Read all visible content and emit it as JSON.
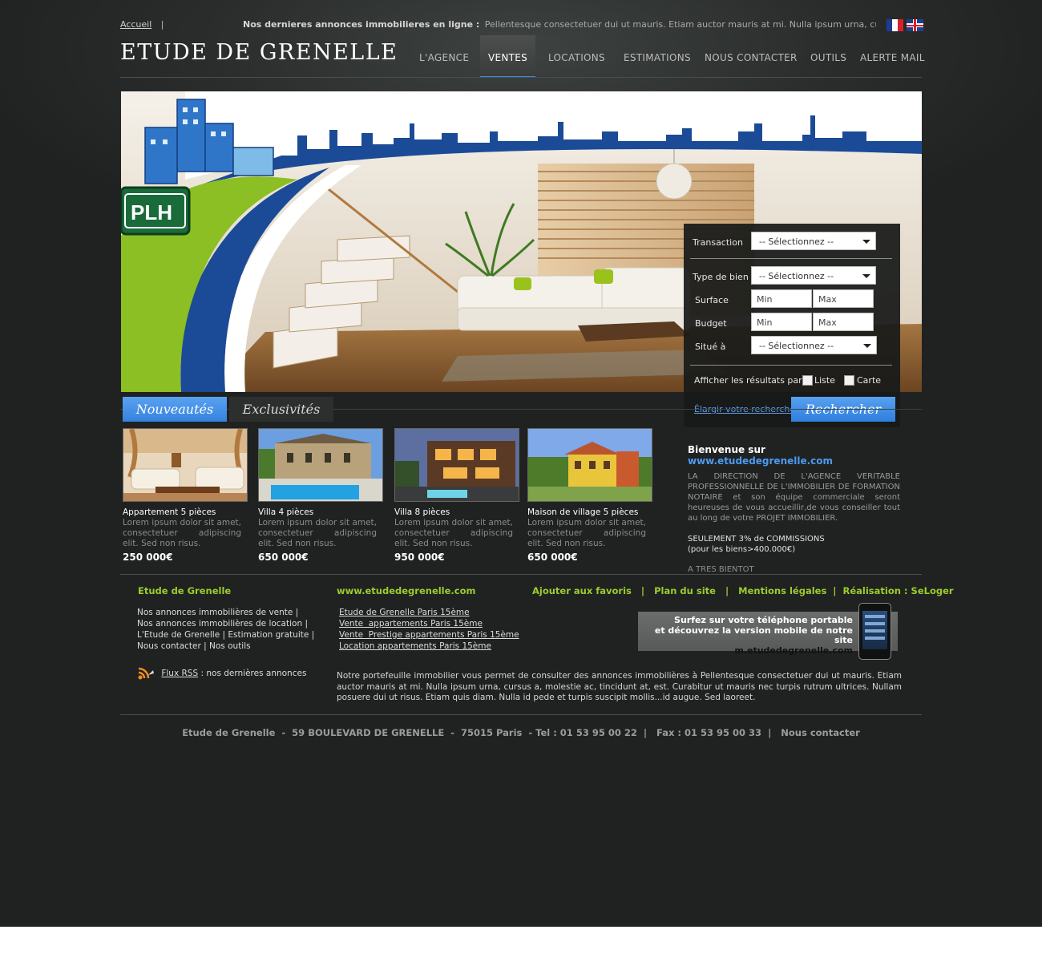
{
  "topbar": {
    "home_link": "Accueil",
    "separator": "|",
    "ticker_label": "Nos dernieres annonces immobilieres en ligne :",
    "ticker_text": "Pellentesque consectetuer dui ut mauris. Etiam auctor mauris at mi. Nulla ipsum urna, cursus a, molestie a..."
  },
  "logo": "ETUDE DE GRENELLE",
  "nav": [
    "L'AGENCE",
    "VENTES",
    "LOCATIONS",
    "ESTIMATIONS",
    "NOUS CONTACTER",
    "OUTILS",
    "ALERTE MAIL"
  ],
  "nav_active": "VENTES",
  "hero": {
    "badge": "PLH"
  },
  "search": {
    "transaction_label": "Transaction",
    "transaction_value": "-- Sélectionnez --",
    "type_label": "Type de bien",
    "type_value": "-- Sélectionnez --",
    "surface_label": "Surface",
    "surface_min": "Min",
    "surface_max": "Max",
    "budget_label": "Budget",
    "budget_min": "Min",
    "budget_max": "Max",
    "location_label": "Situé à",
    "location_value": "-- Sélectionnez --",
    "display_label": "Afficher les résultats par",
    "display_list": "Liste",
    "display_map": "Carte",
    "widen_link": "Élargir votre recherche",
    "submit": "Rechercher"
  },
  "tabs": {
    "new": "Nouveautés",
    "exclusive": "Exclusivités"
  },
  "listings": [
    {
      "title": "Appartement 5 pièces",
      "desc": "Lorem ipsum dolor sit amet, consectetuer adipiscing elit. Sed non risus.",
      "price": "250 000€"
    },
    {
      "title": "Villa 4 pièces",
      "desc": "Lorem ipsum dolor sit amet, consectetuer adipiscing elit. Sed non risus.",
      "price": "650 000€"
    },
    {
      "title": "Villa 8 pièces",
      "desc": "Lorem ipsum dolor sit amet, consectetuer adipiscing elit. Sed non risus.",
      "price": "950 000€"
    },
    {
      "title": "Maison de village 5 pièces",
      "desc": "Lorem ipsum dolor sit amet, consectetuer adipiscing elit. Sed non risus.",
      "price": "650 000€"
    }
  ],
  "welcome": {
    "title_prefix": "Bienvenue sur",
    "title_site": "www.etudedegrenelle.com",
    "body": "LA DIRECTION DE L'AGENCE VERITABLE PROFESSIONNELLE DE L'IMMOBILIER DE FORMATION NOTAIRE et son équipe commerciale seront heureuses de vous accueillir,de vous conseiller tout au long de votre PROJET IMMOBILIER.",
    "commission_1": "SEULEMENT 3% de COMMISSIONS",
    "commission_2": "(pour les biens>400.000€)",
    "signoff": "A TRES BIENTOT"
  },
  "footer": {
    "col1_title": "Etude de Grenelle",
    "col1_links": [
      "Nos annonces immobilières de vente |",
      "Nos annonces immobilières de location |",
      "L'Etude de Grenelle | Estimation gratuite |",
      "Nous contacter | Nos outils"
    ],
    "col2_title": "www.etudedegrenelle.com",
    "col2_links": [
      "Etude de Grenelle Paris 15ème",
      "Vente  appartements Paris 15ème",
      "Vente  Prestige appartements Paris 15ème",
      "Location appartements Paris 15ème"
    ],
    "col3_links": "Ajouter aux favoris   |   Plan du site   |   Mentions légales  |  Réalisation : SeLoger",
    "mobile_line1": "Surfez sur votre téléphone portable",
    "mobile_line2": "et découvrez la version mobile de notre site",
    "mobile_url": "m.etudedegrenelle.com",
    "rss_link": "Flux RSS",
    "rss_text": ": nos dernières annonces",
    "paragraph": "Notre portefeuille immobilier vous permet de consulter des annonces immobilières à Pellentesque consectetuer dui ut mauris. Etiam auctor mauris at mi. Nulla ipsum urna, cursus a, molestie ac, tincidunt at, est. Curabitur ut mauris nec turpis rutrum ultrices. Nullam posuere dui ut risus. Etiam quis diam. Nulla id pede et turpis suscipit mollis...id augue. Sed laoreet.",
    "address": "Etude de Grenelle  -  59 BOULEVARD DE GRENELLE  -  75015 Paris  - Tel : 01 53 95 00 22  |   Fax : 01 53 95 00 33  |   Nous contacter"
  },
  "colors": {
    "accent_blue": "#3d8ce8",
    "footer_green": "#9ccc2e",
    "background": "#1f2221"
  },
  "icons": {
    "language_fr": "flag-fr-icon",
    "language_en": "flag-uk-icon",
    "rss": "rss-icon",
    "dropdown": "chevron-down-icon"
  }
}
